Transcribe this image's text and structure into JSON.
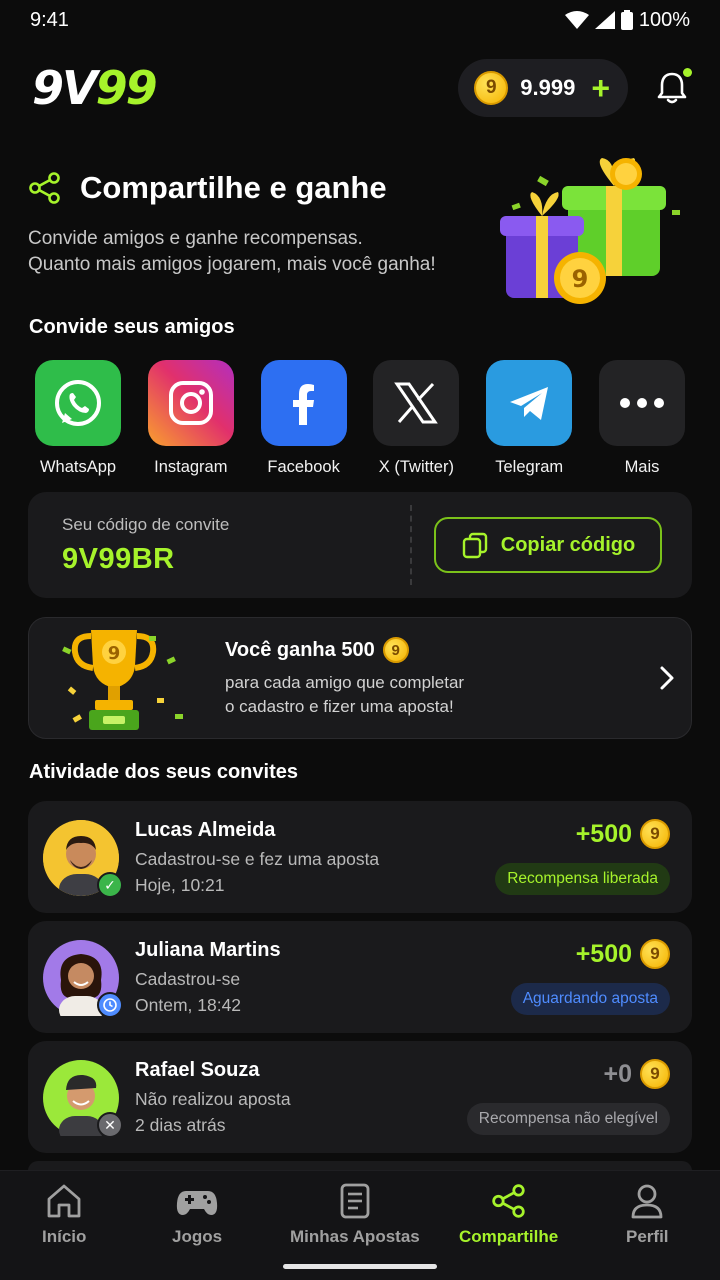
{
  "status_bar": {
    "time": "9:41",
    "battery": "100%"
  },
  "header": {
    "logo_part1": "9V",
    "logo_part2": "99",
    "coin_symbol": "9",
    "balance": "9.999",
    "add_label": "+"
  },
  "hero": {
    "title": "Compartilhe e ganhe",
    "description_line1": "Convide amigos e ganhe recompensas.",
    "description_line2": "Quanto mais amigos jogarem, mais você ganha!"
  },
  "invite": {
    "section_title": "Convide seus amigos",
    "channels": [
      {
        "label": "WhatsApp",
        "icon": "whatsapp-icon",
        "color": "#2fbd4a"
      },
      {
        "label": "Instagram",
        "icon": "instagram-icon",
        "color": "#e1306c"
      },
      {
        "label": "Facebook",
        "icon": "facebook-icon",
        "color": "#2d6ff2"
      },
      {
        "label": "X (Twitter)",
        "icon": "x-icon",
        "color": "#232325"
      },
      {
        "label": "Telegram",
        "icon": "telegram-icon",
        "color": "#2a9be0"
      },
      {
        "label": "Mais",
        "icon": "more-icon",
        "color": "#232325"
      }
    ]
  },
  "code": {
    "caption": "Seu código de convite",
    "value": "9V99BR",
    "copy_label": "Copiar código"
  },
  "reward": {
    "title": "Você ganha 500",
    "coin_symbol": "9",
    "line1": "para cada amigo que completar",
    "line2": "o cadastro e fizer uma aposta!"
  },
  "activity": {
    "section_title": "Atividade dos seus convites",
    "items": [
      {
        "name": "Lucas Almeida",
        "status": "Cadastrou-se e fez uma aposta",
        "time": "Hoje, 10:21",
        "amount": "+500",
        "chip": "Recompensa liberada",
        "state": "released"
      },
      {
        "name": "Juliana Martins",
        "status": "Cadastrou-se",
        "time": "Ontem, 18:42",
        "amount": "+500",
        "chip": "Aguardando aposta",
        "state": "pending"
      },
      {
        "name": "Rafael Souza",
        "status": "Não realizou aposta",
        "time": "2 dias atrás",
        "amount": "+0",
        "chip": "Recompensa não elegível",
        "state": "ineligible"
      }
    ]
  },
  "colors": {
    "accent": "#a6f32b",
    "background": "#0c0c0c",
    "card": "#1a1a1c",
    "pending_blue": "#4f8cff"
  },
  "nav": {
    "items": [
      {
        "label": "Início",
        "icon": "home-icon"
      },
      {
        "label": "Jogos",
        "icon": "gamepad-icon"
      },
      {
        "label": "Minhas Apostas",
        "icon": "bets-icon"
      },
      {
        "label": "Compartilhe",
        "icon": "share-icon",
        "active": true
      },
      {
        "label": "Perfil",
        "icon": "profile-icon"
      }
    ]
  }
}
